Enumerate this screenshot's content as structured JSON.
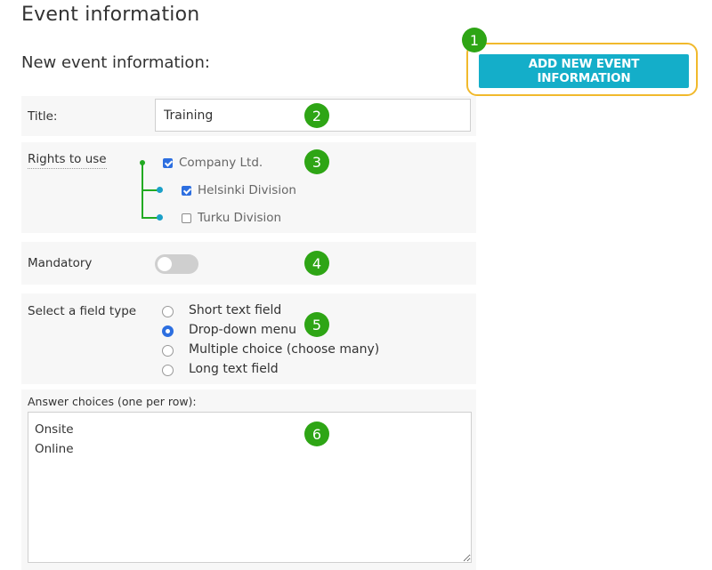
{
  "page": {
    "title": "Event information",
    "subtitle": "New event information:"
  },
  "toolbar": {
    "add_button_label": "ADD NEW EVENT INFORMATION"
  },
  "form": {
    "title_label": "Title:",
    "title_value": "Training",
    "rights_label": "Rights to use",
    "rights": [
      {
        "label": "Company Ltd.",
        "checked": true
      },
      {
        "label": "Helsinki Division",
        "checked": true
      },
      {
        "label": "Turku Division",
        "checked": false
      }
    ],
    "mandatory_label": "Mandatory",
    "mandatory_on": false,
    "field_type_label": "Select a field type",
    "field_types": [
      {
        "label": "Short text field",
        "selected": false
      },
      {
        "label": "Drop-down menu",
        "selected": true
      },
      {
        "label": "Multiple choice (choose many)",
        "selected": false
      },
      {
        "label": "Long text field",
        "selected": false
      }
    ],
    "answer_choices_label": "Answer choices (one per row):",
    "answer_choices_value": "Onsite\nOnline"
  },
  "badges": [
    "1",
    "2",
    "3",
    "4",
    "5",
    "6"
  ],
  "colors": {
    "accent": "#14aec9",
    "highlight": "#f1b92c",
    "badge": "#2ea515",
    "checkbox": "#2d6fe0",
    "tree_line": "#22aa22",
    "tree_dot": "#1ba0c8"
  },
  "icons": {
    "tree": "tree-connector-icon",
    "checkbox": "checkbox-icon",
    "radio": "radio-icon"
  }
}
